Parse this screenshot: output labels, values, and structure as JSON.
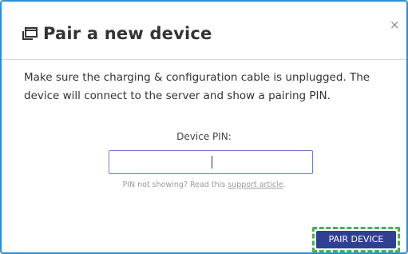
{
  "dialog": {
    "title": "Pair a new device",
    "close_glyph": "×",
    "description": "Make sure the charging & configuration cable is unplugged. The device will connect to the server and show a pairing PIN.",
    "pin": {
      "label": "Device PIN:",
      "value": "",
      "placeholder": ""
    },
    "help": {
      "prefix": "PIN not showing? Read this ",
      "link_text": "support article",
      "suffix": "."
    },
    "pair_button_label": "PAIR DEVICE",
    "icons": {
      "title_icon": "device-window-icon",
      "close_icon": "close-icon"
    },
    "colors": {
      "frame_border": "#2b8fd6",
      "primary_button": "#2f3f94",
      "focus_outline": "#4caf50",
      "input_border": "#6d7dd4"
    }
  }
}
